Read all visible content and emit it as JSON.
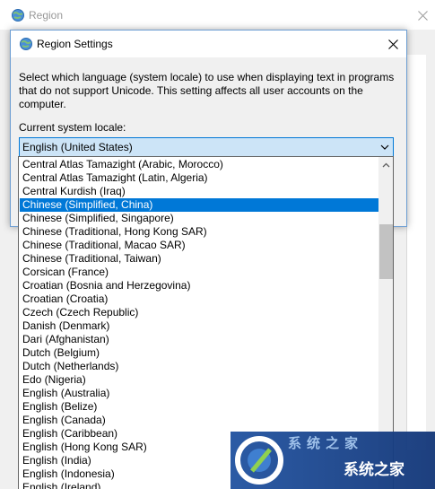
{
  "outer_window": {
    "title": "Region",
    "close_icon": "close-icon"
  },
  "dialog": {
    "title": "Region Settings",
    "description": "Select which language (system locale) to use when displaying text in programs that do not support Unicode. This setting affects all user accounts on the computer.",
    "locale_label": "Current system locale:",
    "selected_locale": "English (United States)"
  },
  "dropdown": {
    "items": [
      "Central Atlas Tamazight (Arabic, Morocco)",
      "Central Atlas Tamazight (Latin, Algeria)",
      "Central Kurdish (Iraq)",
      "Chinese (Simplified, China)",
      "Chinese (Simplified, Singapore)",
      "Chinese (Traditional, Hong Kong SAR)",
      "Chinese (Traditional, Macao SAR)",
      "Chinese (Traditional, Taiwan)",
      "Corsican (France)",
      "Croatian (Bosnia and Herzegovina)",
      "Croatian (Croatia)",
      "Czech (Czech Republic)",
      "Danish (Denmark)",
      "Dari (Afghanistan)",
      "Dutch (Belgium)",
      "Dutch (Netherlands)",
      "Edo (Nigeria)",
      "English (Australia)",
      "English (Belize)",
      "English (Canada)",
      "English (Caribbean)",
      "English (Hong Kong SAR)",
      "English (India)",
      "English (Indonesia)",
      "English (Ireland)"
    ],
    "highlighted": "Chinese (Simplified, China)"
  },
  "watermark": {
    "text": "系统之家",
    "top_text": "系统之家"
  },
  "colors": {
    "selection": "#0078d7",
    "select_bg": "#cce4f7",
    "dialog_border": "#6d9ed3"
  }
}
